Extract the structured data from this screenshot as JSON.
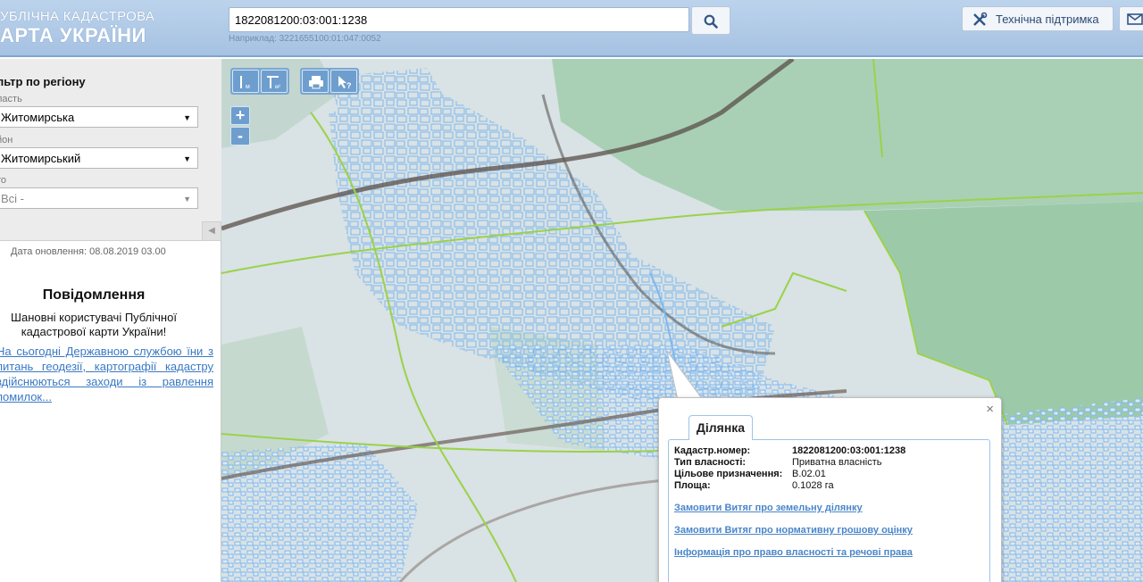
{
  "header": {
    "logo_line1": "УБЛІЧНА КАДАСТРОВА",
    "logo_line2": "АРТА УКРАЇНИ",
    "search_value": "1822081200:03:001:1238",
    "search_hint": "Наприклад: 3221655100:01:047:0052",
    "support_label": "Технічна підтримка"
  },
  "sidebar": {
    "filter_title": "льтр по регіону",
    "region_label": "ласть",
    "region_value": "Житомирська",
    "district_label": "йон",
    "district_value": "Житомирський",
    "city_label": "то",
    "city_value": "Всі -",
    "update_date": "Дата оновлення: 08.08.2019 03.00",
    "notice_title": "Повідомлення",
    "notice_text": "Шановні користувачі Публічної кадастрової карти України!",
    "notice_link": "На сьогодні Державною службою їни з питань геодезії, картографії кадастру здійснюються заходи із равлення помилок..."
  },
  "map": {
    "tools": [
      "ruler-line-icon",
      "ruler-area-icon",
      "print-icon",
      "identify-icon"
    ],
    "zoom_in": "+",
    "zoom_out": "-"
  },
  "popup": {
    "tab_label": "Ділянка",
    "close": "×",
    "fields": [
      {
        "key": "Кадастр.номер:",
        "value": "1822081200:03:001:1238"
      },
      {
        "key": "Тип власності:",
        "value": "Приватна власність"
      },
      {
        "key": "Цільове призначення:",
        "value": "В.02.01"
      },
      {
        "key": "Площа:",
        "value": "0.1028 га"
      }
    ],
    "links": [
      "Замовити Витяг про земельну ділянку",
      "Замовити Витяг про нормативну грошову оцінку",
      "Інформація про право власності та речові права"
    ]
  },
  "colors": {
    "header_bg": "#a6c2e2",
    "link": "#4a86c9",
    "parcel_outline": "#7fb8ee",
    "boundary": "#9ad24a"
  }
}
